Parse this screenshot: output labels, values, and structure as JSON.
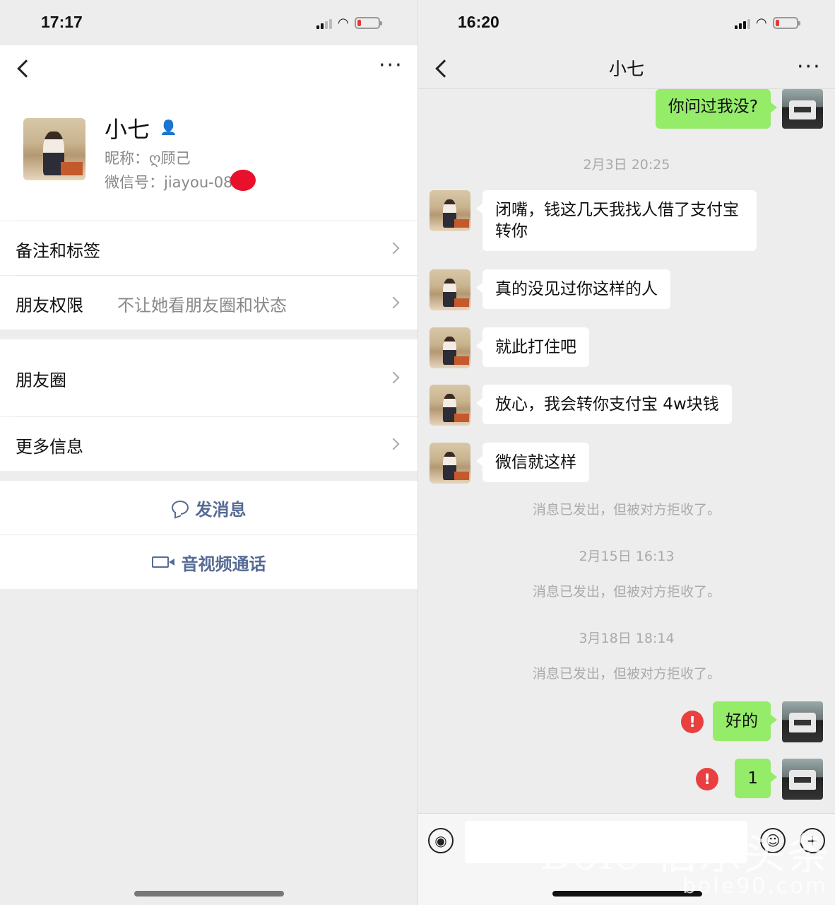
{
  "left": {
    "status_time": "17:17",
    "contact_name": "小七",
    "nickname": "昵称：ღ顾己",
    "wechat_id": "微信号：jiayou-08",
    "rows": {
      "remarks_label": "备注和标签",
      "permission_label": "朋友权限",
      "permission_value": "不让她看朋友圈和状态",
      "moments_label": "朋友圈",
      "more_label": "更多信息"
    },
    "actions": {
      "message": "发消息",
      "call": "音视频通话"
    },
    "icons": [
      "back-icon",
      "more-icon",
      "person-icon",
      "chat-bubble-icon",
      "video-call-icon"
    ]
  },
  "right": {
    "status_time": "16:20",
    "chat_title": "小七",
    "messages": {
      "m0": "你问过我没?",
      "t1": "2月3日 20:25",
      "m1": "闭嘴，钱这几天我找人借了支付宝转你",
      "m2": "真的没见过你这样的人",
      "m3": "就此打住吧",
      "m4": "放心，我会转你支付宝 4w块钱",
      "m5": "微信就这样",
      "rej1": "消息已发出，但被对方拒收了。",
      "t2": "2月15日 16:13",
      "rej2": "消息已发出，但被对方拒收了。",
      "t3": "3月18日 18:14",
      "rej3": "消息已发出，但被对方拒收了。",
      "m6": "好的",
      "m7": "1",
      "err_mark": "!"
    },
    "watermark_line1": "Bole 伯乐头条",
    "watermark_line2": "bole90.com",
    "icons": [
      "back-icon",
      "more-icon",
      "voice-icon",
      "emoji-icon",
      "plus-icon",
      "error-icon"
    ]
  }
}
